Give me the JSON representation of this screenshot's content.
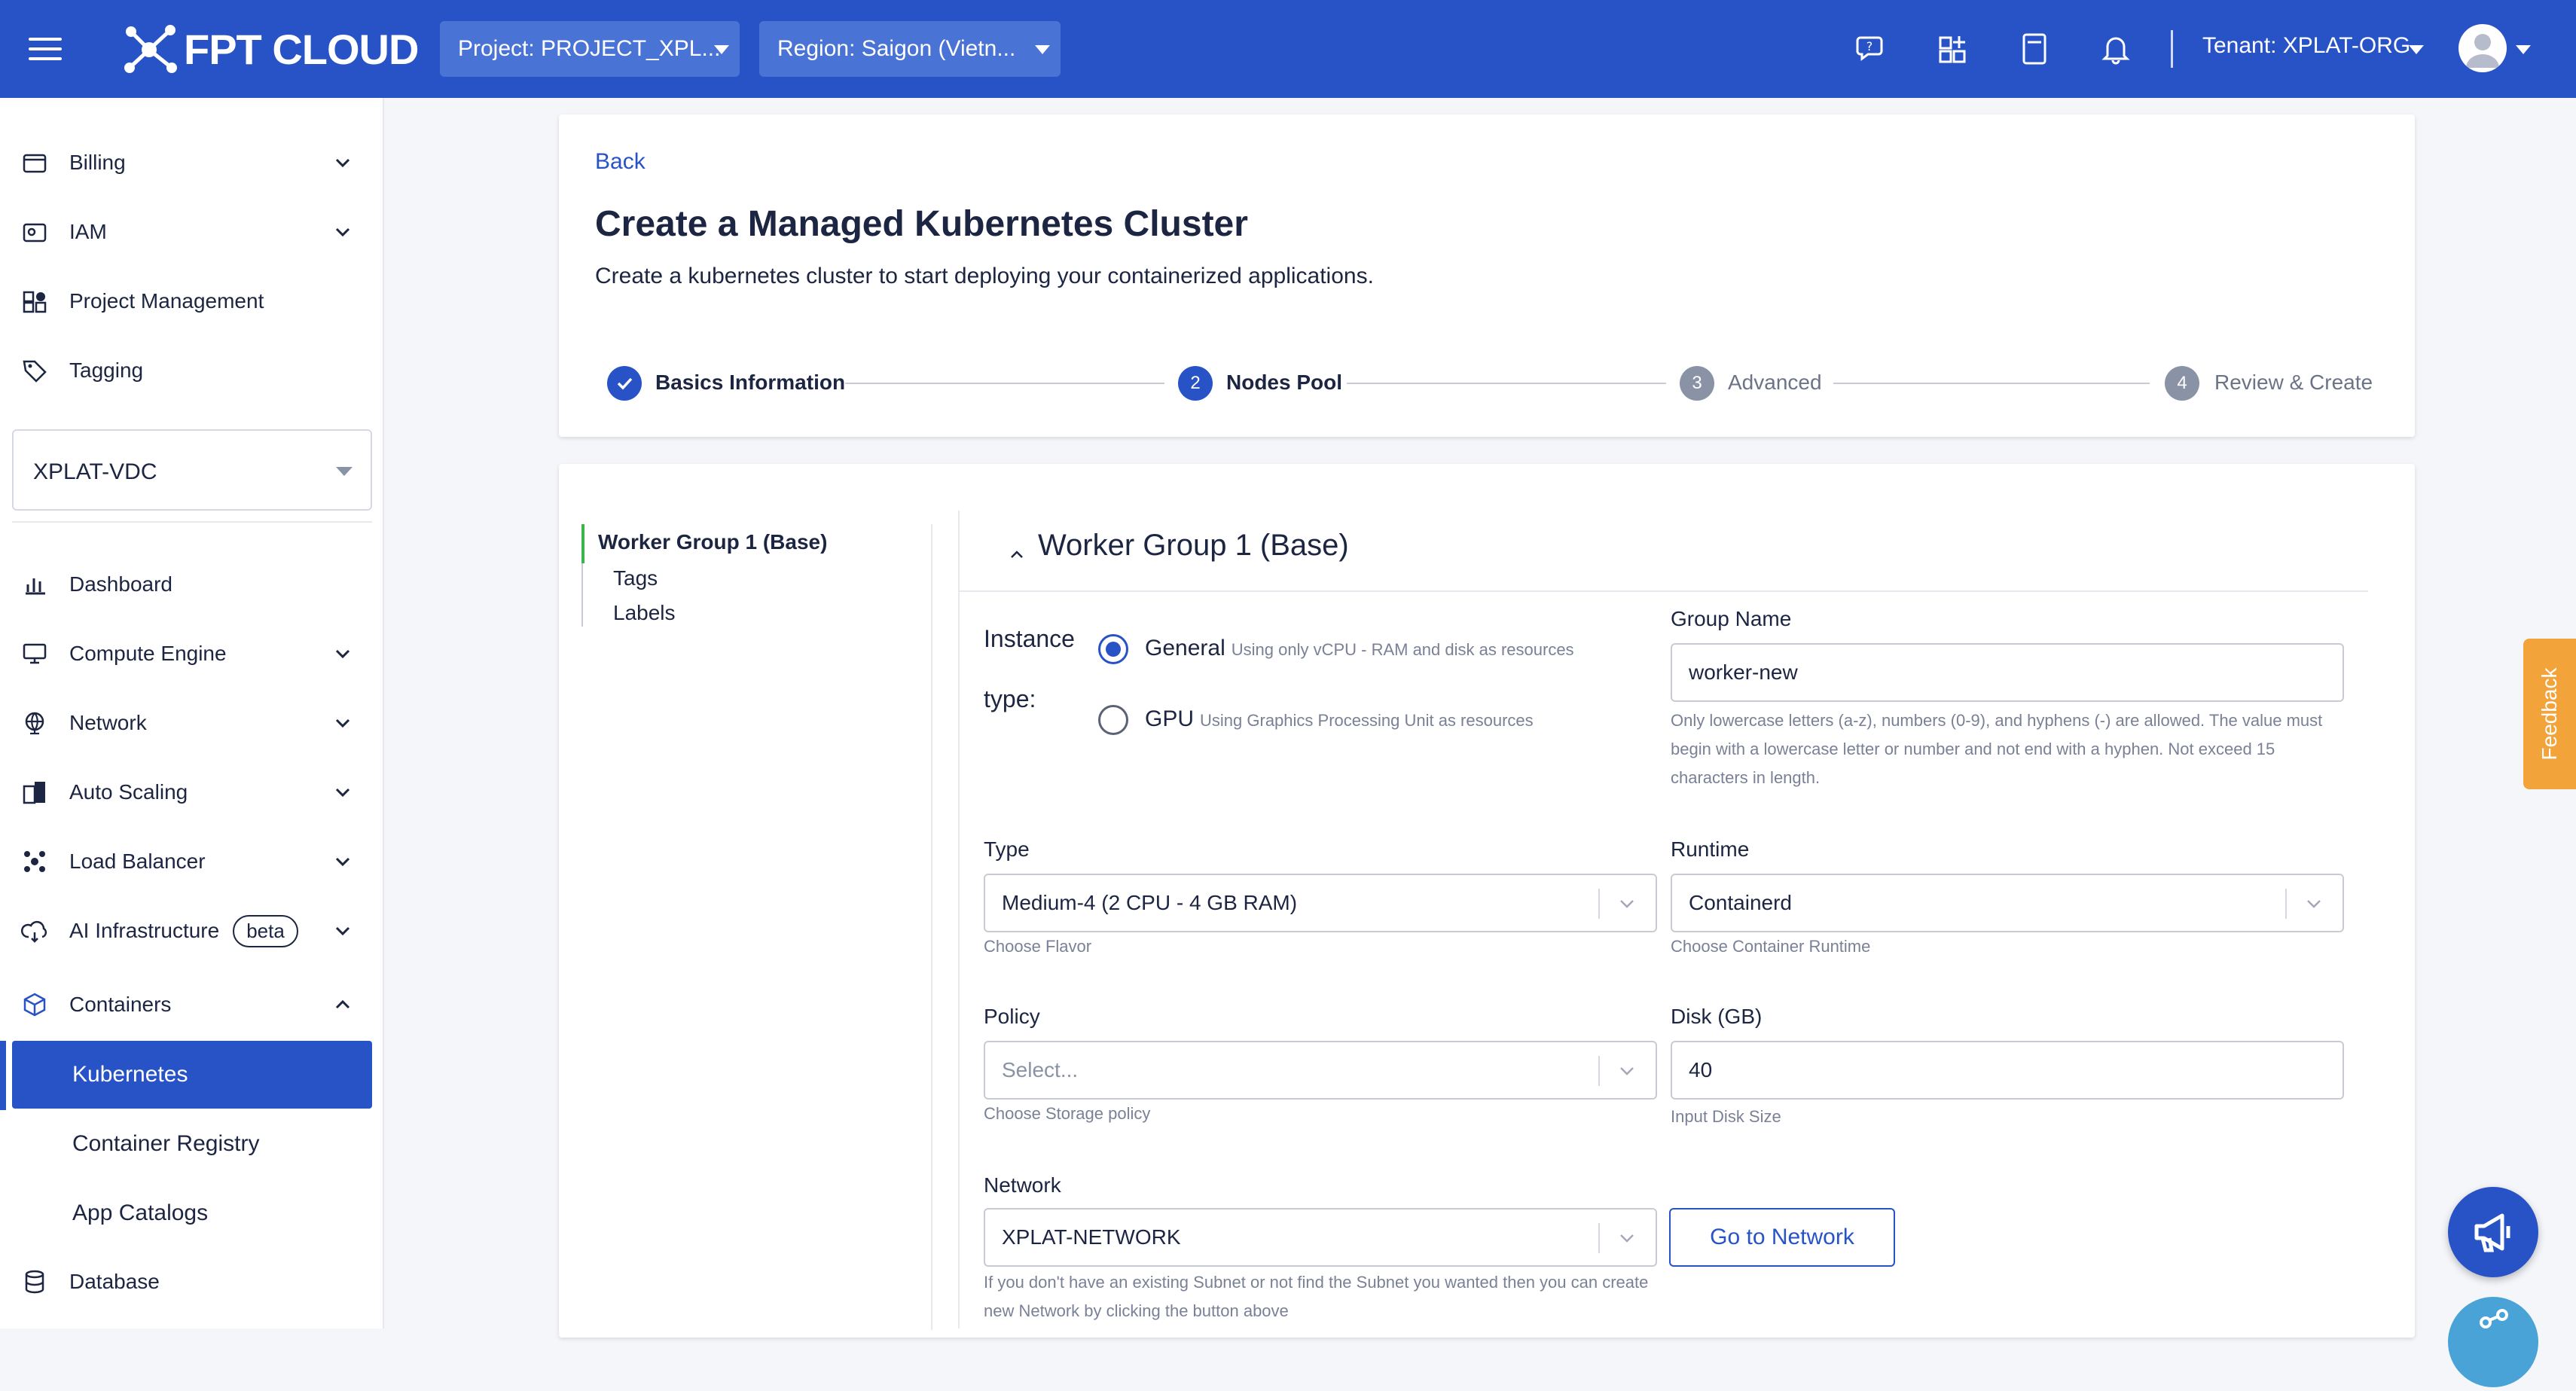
{
  "topbar": {
    "logo": "FPT CLOUD",
    "project_select": "Project: PROJECT_XPL...",
    "region_select": "Region: Saigon (Vietn...",
    "tenant": "Tenant: XPLAT-ORG"
  },
  "sidebar": {
    "items": [
      {
        "label": "Billing"
      },
      {
        "label": "IAM"
      },
      {
        "label": "Project Management"
      },
      {
        "label": "Tagging"
      }
    ],
    "vdc_select": "XPLAT-VDC",
    "main_items": [
      {
        "label": "Dashboard"
      },
      {
        "label": "Compute Engine"
      },
      {
        "label": "Network"
      },
      {
        "label": "Auto Scaling"
      },
      {
        "label": "Load Balancer"
      },
      {
        "label": "AI Infrastructure",
        "badge": "beta"
      },
      {
        "label": "Containers"
      }
    ],
    "sub_items": [
      {
        "label": "Kubernetes"
      },
      {
        "label": "Container Registry"
      },
      {
        "label": "App Catalogs"
      }
    ],
    "database": "Database"
  },
  "header": {
    "back": "Back",
    "title": "Create a Managed Kubernetes Cluster",
    "subtitle": "Create a kubernetes cluster to start deploying your containerized applications."
  },
  "stepper": [
    {
      "num": "✓",
      "label": "Basics Information",
      "state": "done"
    },
    {
      "num": "2",
      "label": "Nodes Pool",
      "state": "active"
    },
    {
      "num": "3",
      "label": "Advanced",
      "state": "pending"
    },
    {
      "num": "4",
      "label": "Review & Create",
      "state": "pending"
    }
  ],
  "toc": {
    "group": "Worker Group 1 (Base)",
    "tags": "Tags",
    "labels": "Labels"
  },
  "worker_group": {
    "title": "Worker Group 1 (Base)",
    "instance_type_label_1": "Instance",
    "instance_type_label_2": "type:",
    "general_label": "General",
    "general_desc": "Using only vCPU - RAM and disk as resources",
    "gpu_label": "GPU",
    "gpu_desc": "Using Graphics Processing Unit as resources",
    "group_name_label": "Group Name",
    "group_name_value": "worker-new",
    "group_name_hint": "Only lowercase letters (a-z), numbers (0-9), and hyphens (-) are allowed. The value must begin with a lowercase letter or number and not end with a hyphen. Not exceed 15 characters in length.",
    "type_label": "Type",
    "type_value": "Medium-4 (2 CPU - 4 GB RAM)",
    "type_hint": "Choose Flavor",
    "runtime_label": "Runtime",
    "runtime_value": "Containerd",
    "runtime_hint": "Choose Container Runtime",
    "policy_label": "Policy",
    "policy_placeholder": "Select...",
    "policy_hint": "Choose Storage policy",
    "disk_label": "Disk (GB)",
    "disk_value": "40",
    "disk_hint": "Input Disk Size",
    "network_label": "Network",
    "network_value": "XPLAT-NETWORK",
    "network_hint": "If you don't have an existing Subnet or not find the Subnet you wanted then you can create new Network by clicking the button above",
    "go_to_network": "Go to Network"
  },
  "feedback": "Feedback",
  "colors": {
    "primary": "#2753c7",
    "feedback": "#f2a33a",
    "done_step": "#2753c7",
    "pending_step": "#8a92a6"
  }
}
